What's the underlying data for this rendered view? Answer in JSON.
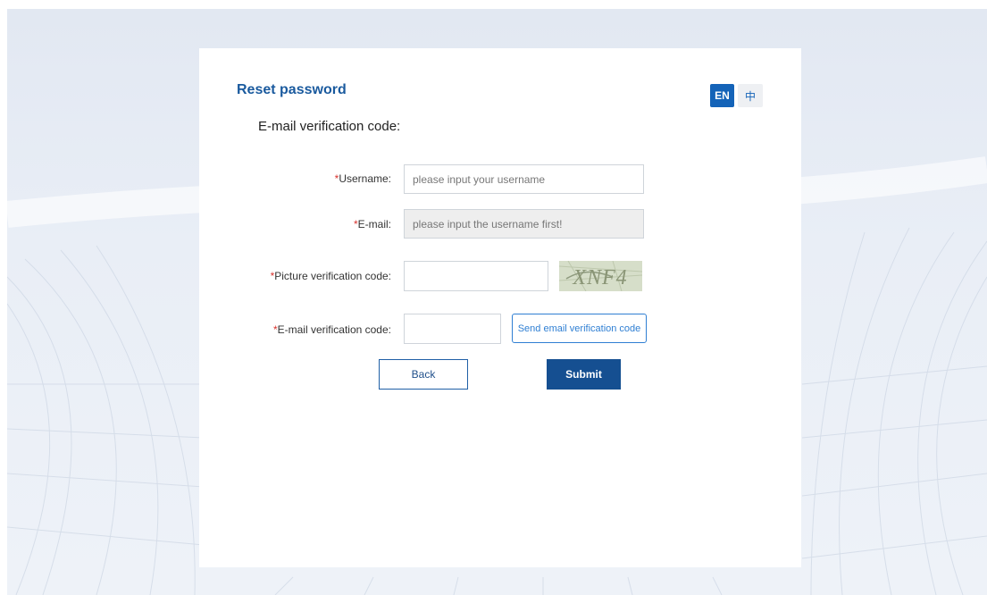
{
  "page": {
    "title": "Reset password",
    "subtitle": "E-mail verification code:"
  },
  "lang": {
    "en_label": "EN",
    "zh_label": "中",
    "active": "EN"
  },
  "form": {
    "required_mark": "*",
    "username": {
      "label": "Username:",
      "value": "",
      "placeholder": "please input your username"
    },
    "email": {
      "label": "E-mail:",
      "value": "",
      "placeholder": "please input the username first!",
      "disabled": true
    },
    "picture_code": {
      "label": "Picture verification code:",
      "value": "",
      "placeholder": ""
    },
    "captcha_text": "XNF4",
    "email_code": {
      "label": "E-mail verification code:",
      "value": "",
      "placeholder": ""
    },
    "send_email_code_label": "Send email verification code"
  },
  "actions": {
    "back_label": "Back",
    "submit_label": "Submit"
  },
  "colors": {
    "brand": "#1463b8",
    "title": "#1a5a9e",
    "submit_bg": "#154f91",
    "required": "#d9332e",
    "page_bg": "#e6ecf4"
  }
}
